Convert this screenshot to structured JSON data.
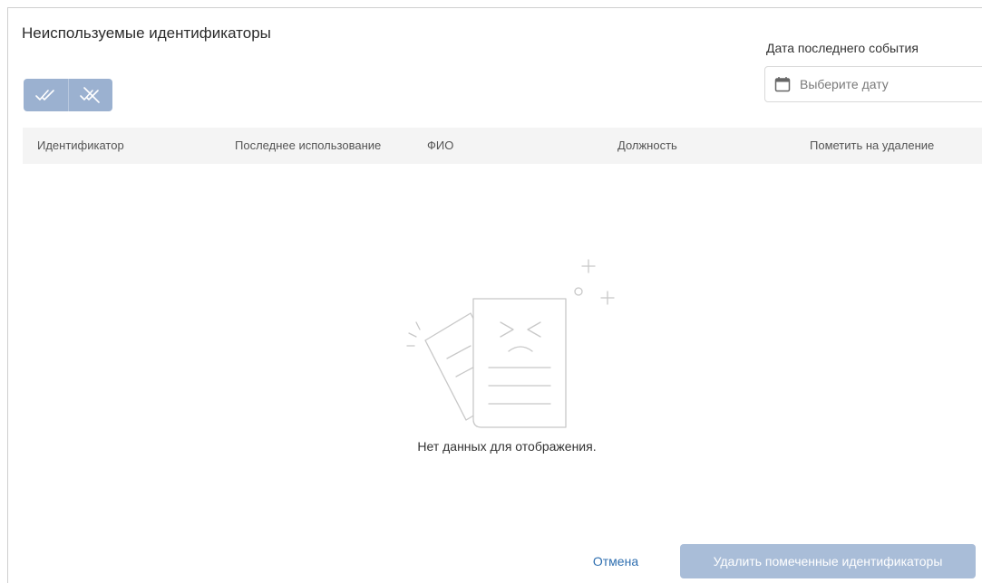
{
  "dialog": {
    "title": "Неиспользуемые идентификаторы"
  },
  "toolbar": {
    "select_all_icon": "double-check-icon",
    "deselect_all_icon": "double-check-crossed-icon"
  },
  "filter": {
    "date_label": "Дата последнего события",
    "date_placeholder": "Выберите дату",
    "date_icon": "calendar-icon"
  },
  "table": {
    "columns": [
      "Идентификатор",
      "Последнее использование",
      "ФИО",
      "Должность",
      "Пометить на удаление"
    ],
    "rows": [],
    "empty_text": "Нет данных для отображения.",
    "empty_icon": "empty-document-icon"
  },
  "footer": {
    "cancel_label": "Отмена",
    "delete_label": "Удалить помеченные идентификаторы"
  },
  "colors": {
    "primary_disabled": "#a9bdd8",
    "link": "#2f6fb0",
    "header_bg": "#f4f4f4"
  }
}
